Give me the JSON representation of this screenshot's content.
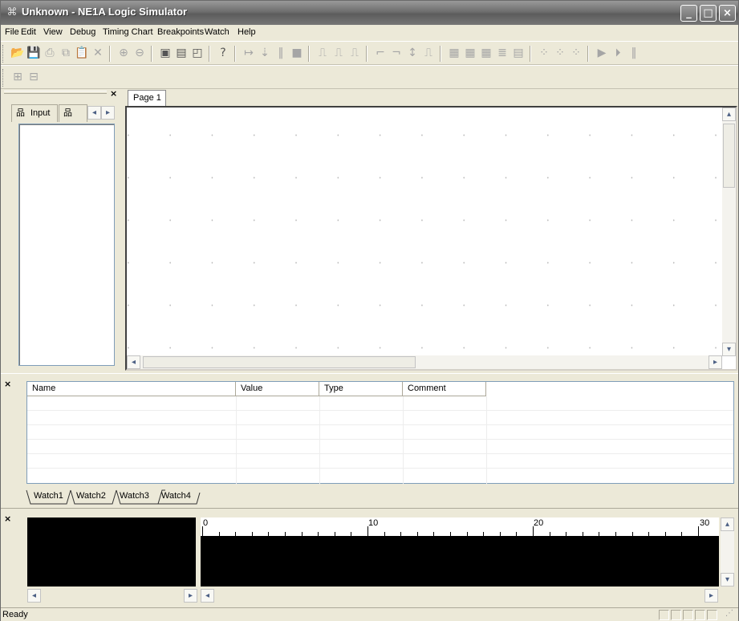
{
  "window": {
    "title": "Unknown - NE1A Logic Simulator",
    "controls": {
      "minimize": "minimize-icon",
      "maximize": "maximize-icon",
      "close": "close-icon"
    }
  },
  "menu": [
    "File",
    "Edit",
    "View",
    "Debug",
    "Timing Chart",
    "Breakpoints",
    "Watch",
    "Help"
  ],
  "left_pane": {
    "tab_label": "Input"
  },
  "page_tab": "Page 1",
  "watch": {
    "columns": [
      "Name",
      "Value",
      "Type",
      "Comment"
    ],
    "tabs": [
      "Watch1",
      "Watch2",
      "Watch3",
      "Watch4"
    ]
  },
  "timing": {
    "ruler_labels": [
      "0",
      "10",
      "20",
      "30"
    ]
  },
  "status": {
    "text": "Ready"
  }
}
